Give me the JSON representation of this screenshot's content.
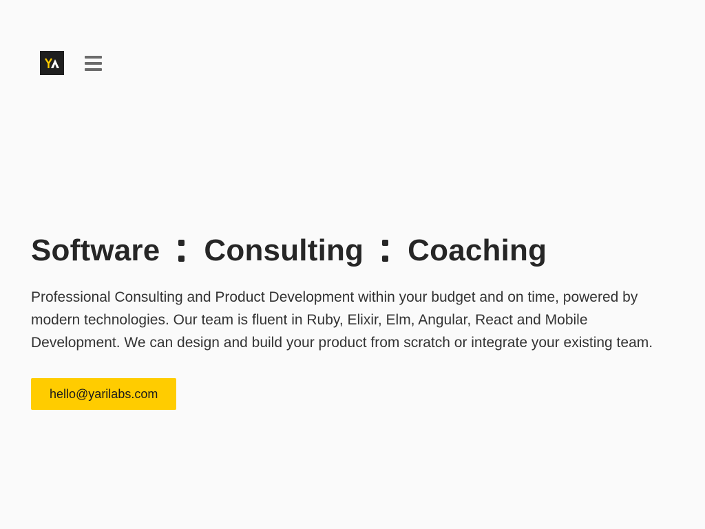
{
  "header": {
    "logo_text": "YA",
    "menu_icon": "hamburger-menu-icon"
  },
  "hero": {
    "headline_parts": [
      "Software",
      "Consulting",
      "Coaching"
    ],
    "description": "Professional Consulting and Product Development within your budget and on time, powered by modern technologies. Our team is fluent in Ruby, Elixir, Elm, Angular, React and Mobile Development. We can design and build your product from scratch or integrate your existing team.",
    "cta_label": "hello@yarilabs.com"
  },
  "colors": {
    "background": "#fafafa",
    "accent": "#ffcc00",
    "logo_background": "#1f1f1f",
    "text": "#262626"
  }
}
